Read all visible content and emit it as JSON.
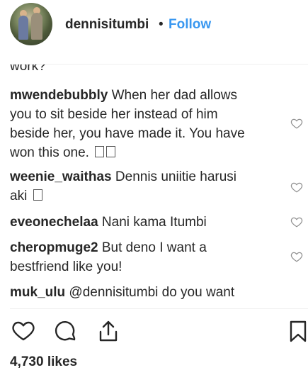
{
  "header": {
    "username": "dennisitumbi",
    "separator": "•",
    "follow_label": "Follow"
  },
  "comments": {
    "partial_text": "work?",
    "items": [
      {
        "user": "mwendebubbly",
        "lines": [
          "When her dad allows",
          "you to sit beside her instead of him",
          "beside her, you have made it. You have",
          "won this one."
        ],
        "emoji_count": 2
      },
      {
        "user": "weenie_waithas",
        "lines": [
          "Dennis uniitie harusi",
          "aki"
        ],
        "emoji_count": 1
      },
      {
        "user": "eveonechelaa",
        "lines": [
          "Nani kama Itumbi"
        ],
        "emoji_count": 0
      },
      {
        "user": "cheropmuge2",
        "lines": [
          "But deno I want a",
          "bestfriend like you!"
        ],
        "emoji_count": 0
      },
      {
        "user": "muk_ulu",
        "lines": [
          "@dennisitumbi do you want"
        ],
        "emoji_count": 0
      }
    ]
  },
  "actions": {
    "like_icon": "heart-icon",
    "comment_icon": "comment-bubble-icon",
    "share_icon": "share-icon",
    "save_icon": "bookmark-icon"
  },
  "likes_text": "4,730 likes",
  "colors": {
    "link": "#3897f0",
    "text": "#262626",
    "divider": "#efefef"
  }
}
